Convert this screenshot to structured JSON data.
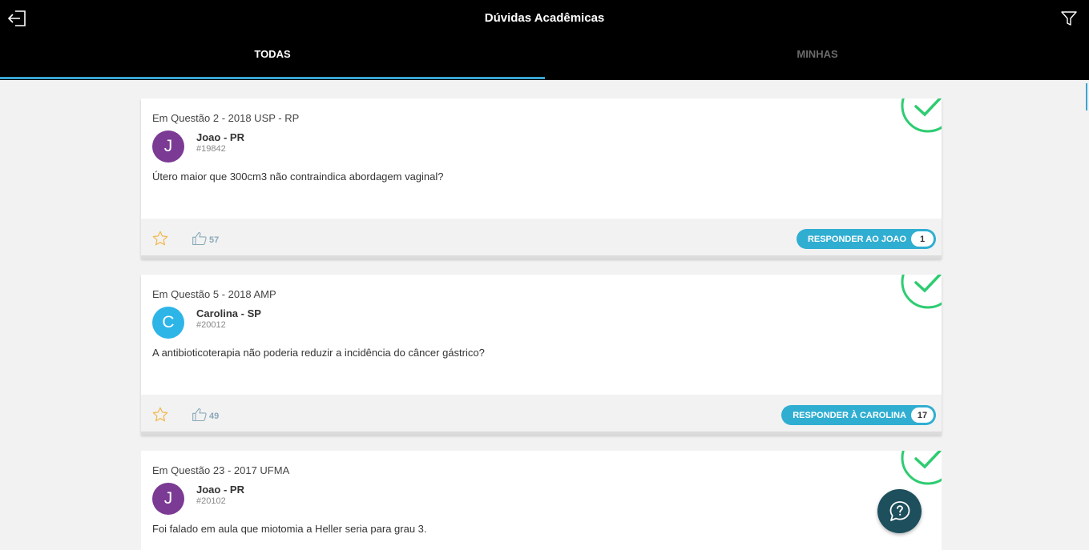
{
  "header": {
    "title": "Dúvidas Acadêmicas",
    "tabs": [
      {
        "label": "TODAS",
        "active": true
      },
      {
        "label": "MINHAS",
        "active": false
      }
    ]
  },
  "colors": {
    "accent": "#3aa6d0",
    "reply_button": "#30aed2",
    "check_green": "#2ecc71",
    "fab": "#1d4f5c"
  },
  "posts": [
    {
      "meta": "Em Questão 2 - 2018 USP - RP",
      "avatar_letter": "J",
      "avatar_color": "#7b3a94",
      "author": "Joao - PR",
      "id": "#19842",
      "question": "Útero maior que 300cm3 não contraindica abordagem vaginal?",
      "likes": "57",
      "reply_label": "RESPONDER AO JOAO",
      "reply_count": "1"
    },
    {
      "meta": "Em Questão 5 - 2018 AMP",
      "avatar_letter": "C",
      "avatar_color": "#2db5e8",
      "author": "Carolina - SP",
      "id": "#20012",
      "question": "A antibioticoterapia não poderia reduzir a incidência do câncer gástrico?",
      "likes": "49",
      "reply_label": "RESPONDER À CAROLINA",
      "reply_count": "17"
    },
    {
      "meta": "Em Questão 23 - 2017 UFMA",
      "avatar_letter": "J",
      "avatar_color": "#7b3a94",
      "author": "Joao - PR",
      "id": "#20102",
      "question": "Foi falado em aula que miotomia a Heller seria para grau 3."
    }
  ]
}
